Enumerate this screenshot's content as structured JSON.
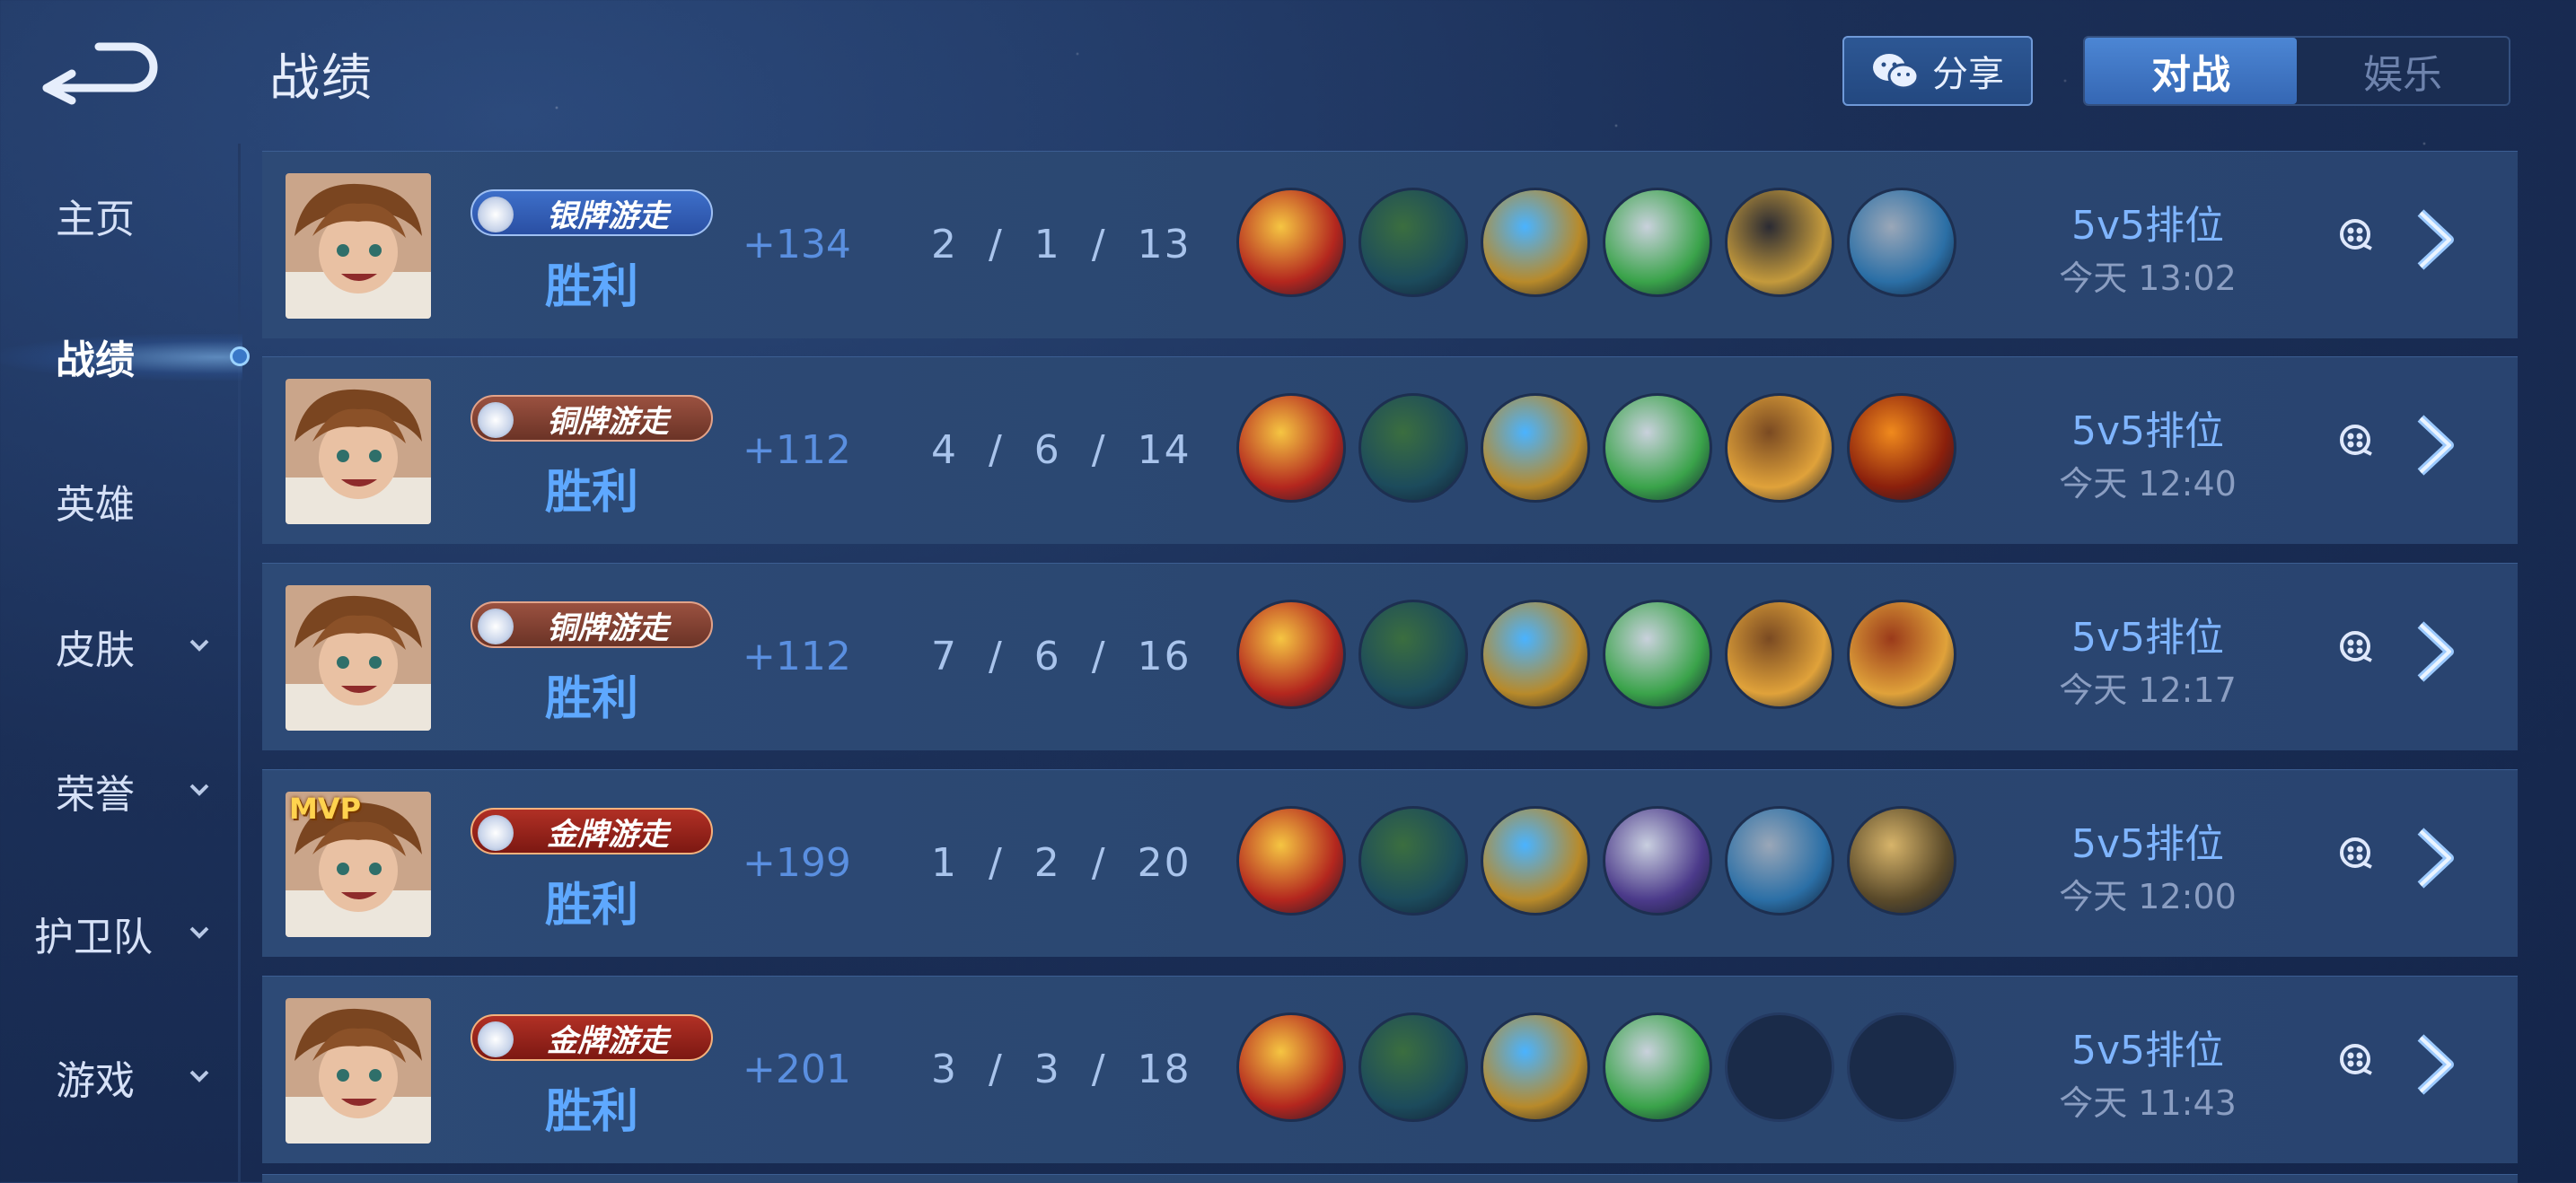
{
  "header": {
    "title": "战绩",
    "share_label": "分享",
    "tabs": [
      {
        "label": "对战",
        "active": true
      },
      {
        "label": "娱乐",
        "active": false
      }
    ]
  },
  "sidebar": {
    "items": [
      {
        "label": "主页",
        "active": false,
        "expandable": false
      },
      {
        "label": "战绩",
        "active": true,
        "expandable": false
      },
      {
        "label": "英雄",
        "active": false,
        "expandable": false
      },
      {
        "label": "皮肤",
        "active": false,
        "expandable": true
      },
      {
        "label": "荣誉",
        "active": false,
        "expandable": true
      },
      {
        "label": "护卫队",
        "active": false,
        "expandable": true
      },
      {
        "label": "游戏",
        "active": false,
        "expandable": true
      }
    ]
  },
  "matches": [
    {
      "mvp": false,
      "badge": "银牌游走",
      "badge_tier": "silver",
      "result": "胜利",
      "score": "+134",
      "kda": "2 / 1 / 13",
      "mode": "5v5排位",
      "time": "今天 13:02",
      "items": [
        "gold-red-sword",
        "green-boots",
        "blue-gold-emblem",
        "green-silver-wings",
        "black-gold-armor",
        "silver-blue-belt"
      ]
    },
    {
      "mvp": false,
      "badge": "铜牌游走",
      "badge_tier": "bronze",
      "result": "胜利",
      "score": "+112",
      "kda": "4 / 6 / 14",
      "mode": "5v5排位",
      "time": "今天 12:40",
      "items": [
        "gold-red-sword",
        "green-boots",
        "blue-gold-emblem",
        "green-silver-wings",
        "brown-spiked-armor",
        "fire-orb"
      ]
    },
    {
      "mvp": false,
      "badge": "铜牌游走",
      "badge_tier": "bronze",
      "result": "胜利",
      "score": "+112",
      "kda": "7 / 6 / 16",
      "mode": "5v5排位",
      "time": "今天 12:17",
      "items": [
        "gold-red-sword",
        "green-boots",
        "blue-gold-emblem",
        "green-silver-wings",
        "brown-spiked-armor",
        "red-gold-helm"
      ]
    },
    {
      "mvp": true,
      "mvp_label": "MVP",
      "badge": "金牌游走",
      "badge_tier": "gold",
      "result": "胜利",
      "score": "+199",
      "kda": "1 / 2 / 20",
      "mode": "5v5排位",
      "time": "今天 12:00",
      "items": [
        "gold-red-sword",
        "green-boots",
        "blue-gold-emblem",
        "purple-silver-armor",
        "silver-blue-belt",
        "gold-cloak"
      ]
    },
    {
      "mvp": false,
      "badge": "金牌游走",
      "badge_tier": "gold",
      "result": "胜利",
      "score": "+201",
      "kda": "3 / 3 / 18",
      "mode": "5v5排位",
      "time": "今天 11:43",
      "items": [
        "gold-red-sword",
        "green-boots",
        "blue-gold-emblem",
        "green-silver-wings",
        "empty",
        "empty"
      ]
    }
  ],
  "colors": {
    "accent_blue": "#5ea8ff",
    "score_blue": "#5a8fe0",
    "row_bg": "#2d4a76",
    "page_bg": "#1b2f57"
  }
}
